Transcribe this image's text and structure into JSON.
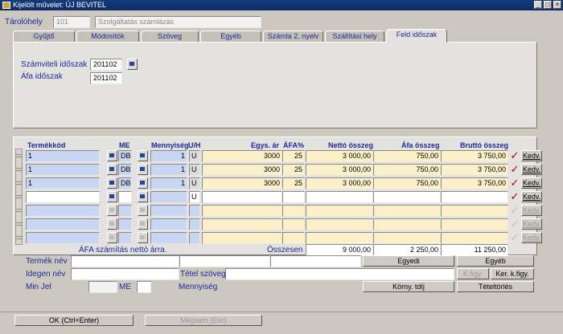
{
  "window": {
    "title": "Kijelölt művelet: ÚJ BEVITEL"
  },
  "header": {
    "taroloh_label": "Tárolóhely",
    "taroloh_code": "101",
    "taroloh_name": "Szolgáltatás számlázás"
  },
  "tabs": [
    {
      "label": "Gyűjtő"
    },
    {
      "label": "Módosítók"
    },
    {
      "label": "Szöveg"
    },
    {
      "label": "Egyéb"
    },
    {
      "label": "Számla 2. nyelv"
    },
    {
      "label": "Szállítási hely"
    },
    {
      "label": "Feld időszak"
    }
  ],
  "panel": {
    "szamviteli_label": "Számviteli időszak",
    "szamviteli_value": "201102",
    "afa_label": "Áfa időszak",
    "afa_value": "201102"
  },
  "grid": {
    "headers": {
      "termekkod": "Termékkód",
      "me": "ME",
      "mennyiseg": "Mennyiség",
      "uh": "U/H",
      "egys_ar": "Egys. ár",
      "afa_pct": "ÁFA%",
      "netto": "Nettó összeg",
      "afa": "Áfa összeg",
      "brutto": "Bruttó összeg"
    },
    "rows": [
      {
        "kod": "1",
        "me": "DB",
        "menny": "1",
        "uh": "U",
        "ar": "3000",
        "afa_pct": "25",
        "netto": "3 000,00",
        "afa": "750,00",
        "brutto": "3 750,00",
        "kedv": "Kedv."
      },
      {
        "kod": "1",
        "me": "DB",
        "menny": "1",
        "uh": "U",
        "ar": "3000",
        "afa_pct": "25",
        "netto": "3 000,00",
        "afa": "750,00",
        "brutto": "3 750,00",
        "kedv": "Kedv."
      },
      {
        "kod": "1",
        "me": "DB",
        "menny": "1",
        "uh": "U",
        "ar": "3000",
        "afa_pct": "25",
        "netto": "3 000,00",
        "afa": "750,00",
        "brutto": "3 750,00",
        "kedv": "Kedv."
      },
      {
        "kod": "",
        "me": "",
        "menny": "",
        "uh": "U",
        "ar": "",
        "afa_pct": "",
        "netto": "",
        "afa": "",
        "brutto": "",
        "kedv": "Kedv."
      },
      {
        "kod": "",
        "me": "",
        "menny": "",
        "uh": "",
        "ar": "",
        "afa_pct": "",
        "netto": "",
        "afa": "",
        "brutto": "",
        "kedv": "Kedv."
      },
      {
        "kod": "",
        "me": "",
        "menny": "",
        "uh": "",
        "ar": "",
        "afa_pct": "",
        "netto": "",
        "afa": "",
        "brutto": "",
        "kedv": "Kedv."
      },
      {
        "kod": "",
        "me": "",
        "menny": "",
        "uh": "",
        "ar": "",
        "afa_pct": "",
        "netto": "",
        "afa": "",
        "brutto": "",
        "kedv": "Kedv."
      }
    ],
    "note": "ÁFA számítás nettó árra.",
    "osszesen_label": "Összesen",
    "total_netto": "9 000,00",
    "total_afa": "2 250,00",
    "total_brutto": "11 250,00"
  },
  "bottom": {
    "termek_nev": "Termék név",
    "idegen_nev": "Idegen név",
    "tetel_szoveg": "Tétel szöveg",
    "min_jel": "Min Jel",
    "me": "ME",
    "mennyiseg": "Mennyiség"
  },
  "buttons": {
    "egyedi": "Egyedi",
    "egyeb": "Egyéb",
    "kfigy": "K.figy.",
    "ker_kfigy": "Ker. k.figy.",
    "korny_tdij": "Körny. tdíj",
    "tetel_torles": "Tételtörlés",
    "ok": "OK (Ctrl+Enter)",
    "megsem": "Mégsem (Esc)"
  }
}
